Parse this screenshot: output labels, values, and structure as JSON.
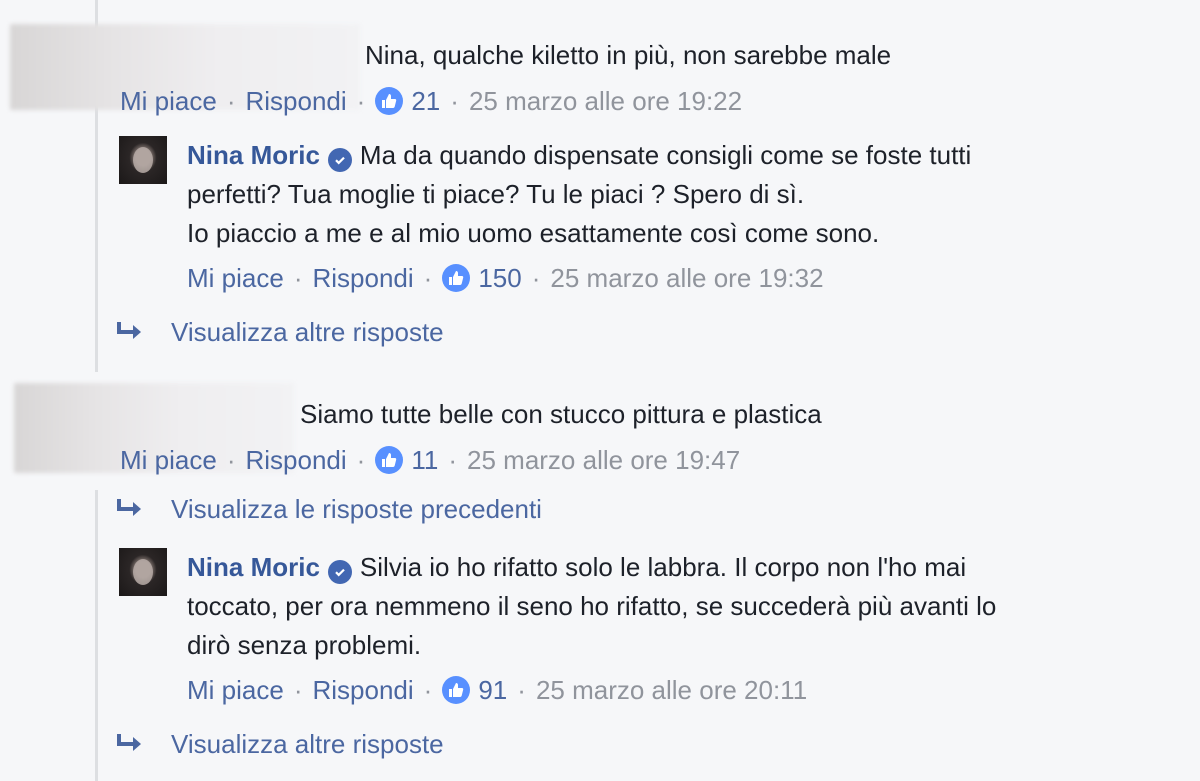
{
  "comments": [
    {
      "author_blurred": true,
      "text": "Nina, qualche kiletto in più, non sarebbe male",
      "actions": {
        "like": "Mi piace",
        "reply": "Rispondi",
        "likes": "21",
        "time": "25 marzo alle ore 19:22"
      },
      "reply": {
        "author": "Nina Moric",
        "lines": [
          "Ma da quando dispensate consigli come se foste tutti",
          "perfetti? Tua moglie ti piace? Tu le piaci ? Spero di sì.",
          "Io piaccio a me e al mio uomo esattamente così come sono."
        ],
        "actions": {
          "like": "Mi piace",
          "reply": "Rispondi",
          "likes": "150",
          "time": "25 marzo alle ore 19:32"
        }
      },
      "view_more": "Visualizza altre risposte"
    },
    {
      "author_blurred": true,
      "text": "Siamo tutte belle con stucco pittura e plastica",
      "actions": {
        "like": "Mi piace",
        "reply": "Rispondi",
        "likes": "11",
        "time": "25 marzo alle ore 19:47"
      },
      "view_previous": "Visualizza le risposte precedenti",
      "reply": {
        "author": "Nina Moric",
        "lines": [
          "Silvia io ho rifatto solo le labbra. Il corpo non l'ho mai",
          "toccato, per ora nemmeno il seno ho rifatto, se succederà più avanti lo",
          "dirò senza problemi."
        ],
        "actions": {
          "like": "Mi piace",
          "reply": "Rispondi",
          "likes": "91",
          "time": "25 marzo alle ore 20:11"
        }
      },
      "view_more": "Visualizza altre risposte"
    }
  ],
  "icons": {
    "like": "thumbs-up-icon",
    "verified": "verified-check-icon",
    "reply_arrow": "reply-arrow-icon"
  },
  "colors": {
    "link": "#4b67a1",
    "author": "#365899",
    "meta": "#90949c",
    "like_badge": "#5890ff",
    "verified": "#4267b2"
  }
}
